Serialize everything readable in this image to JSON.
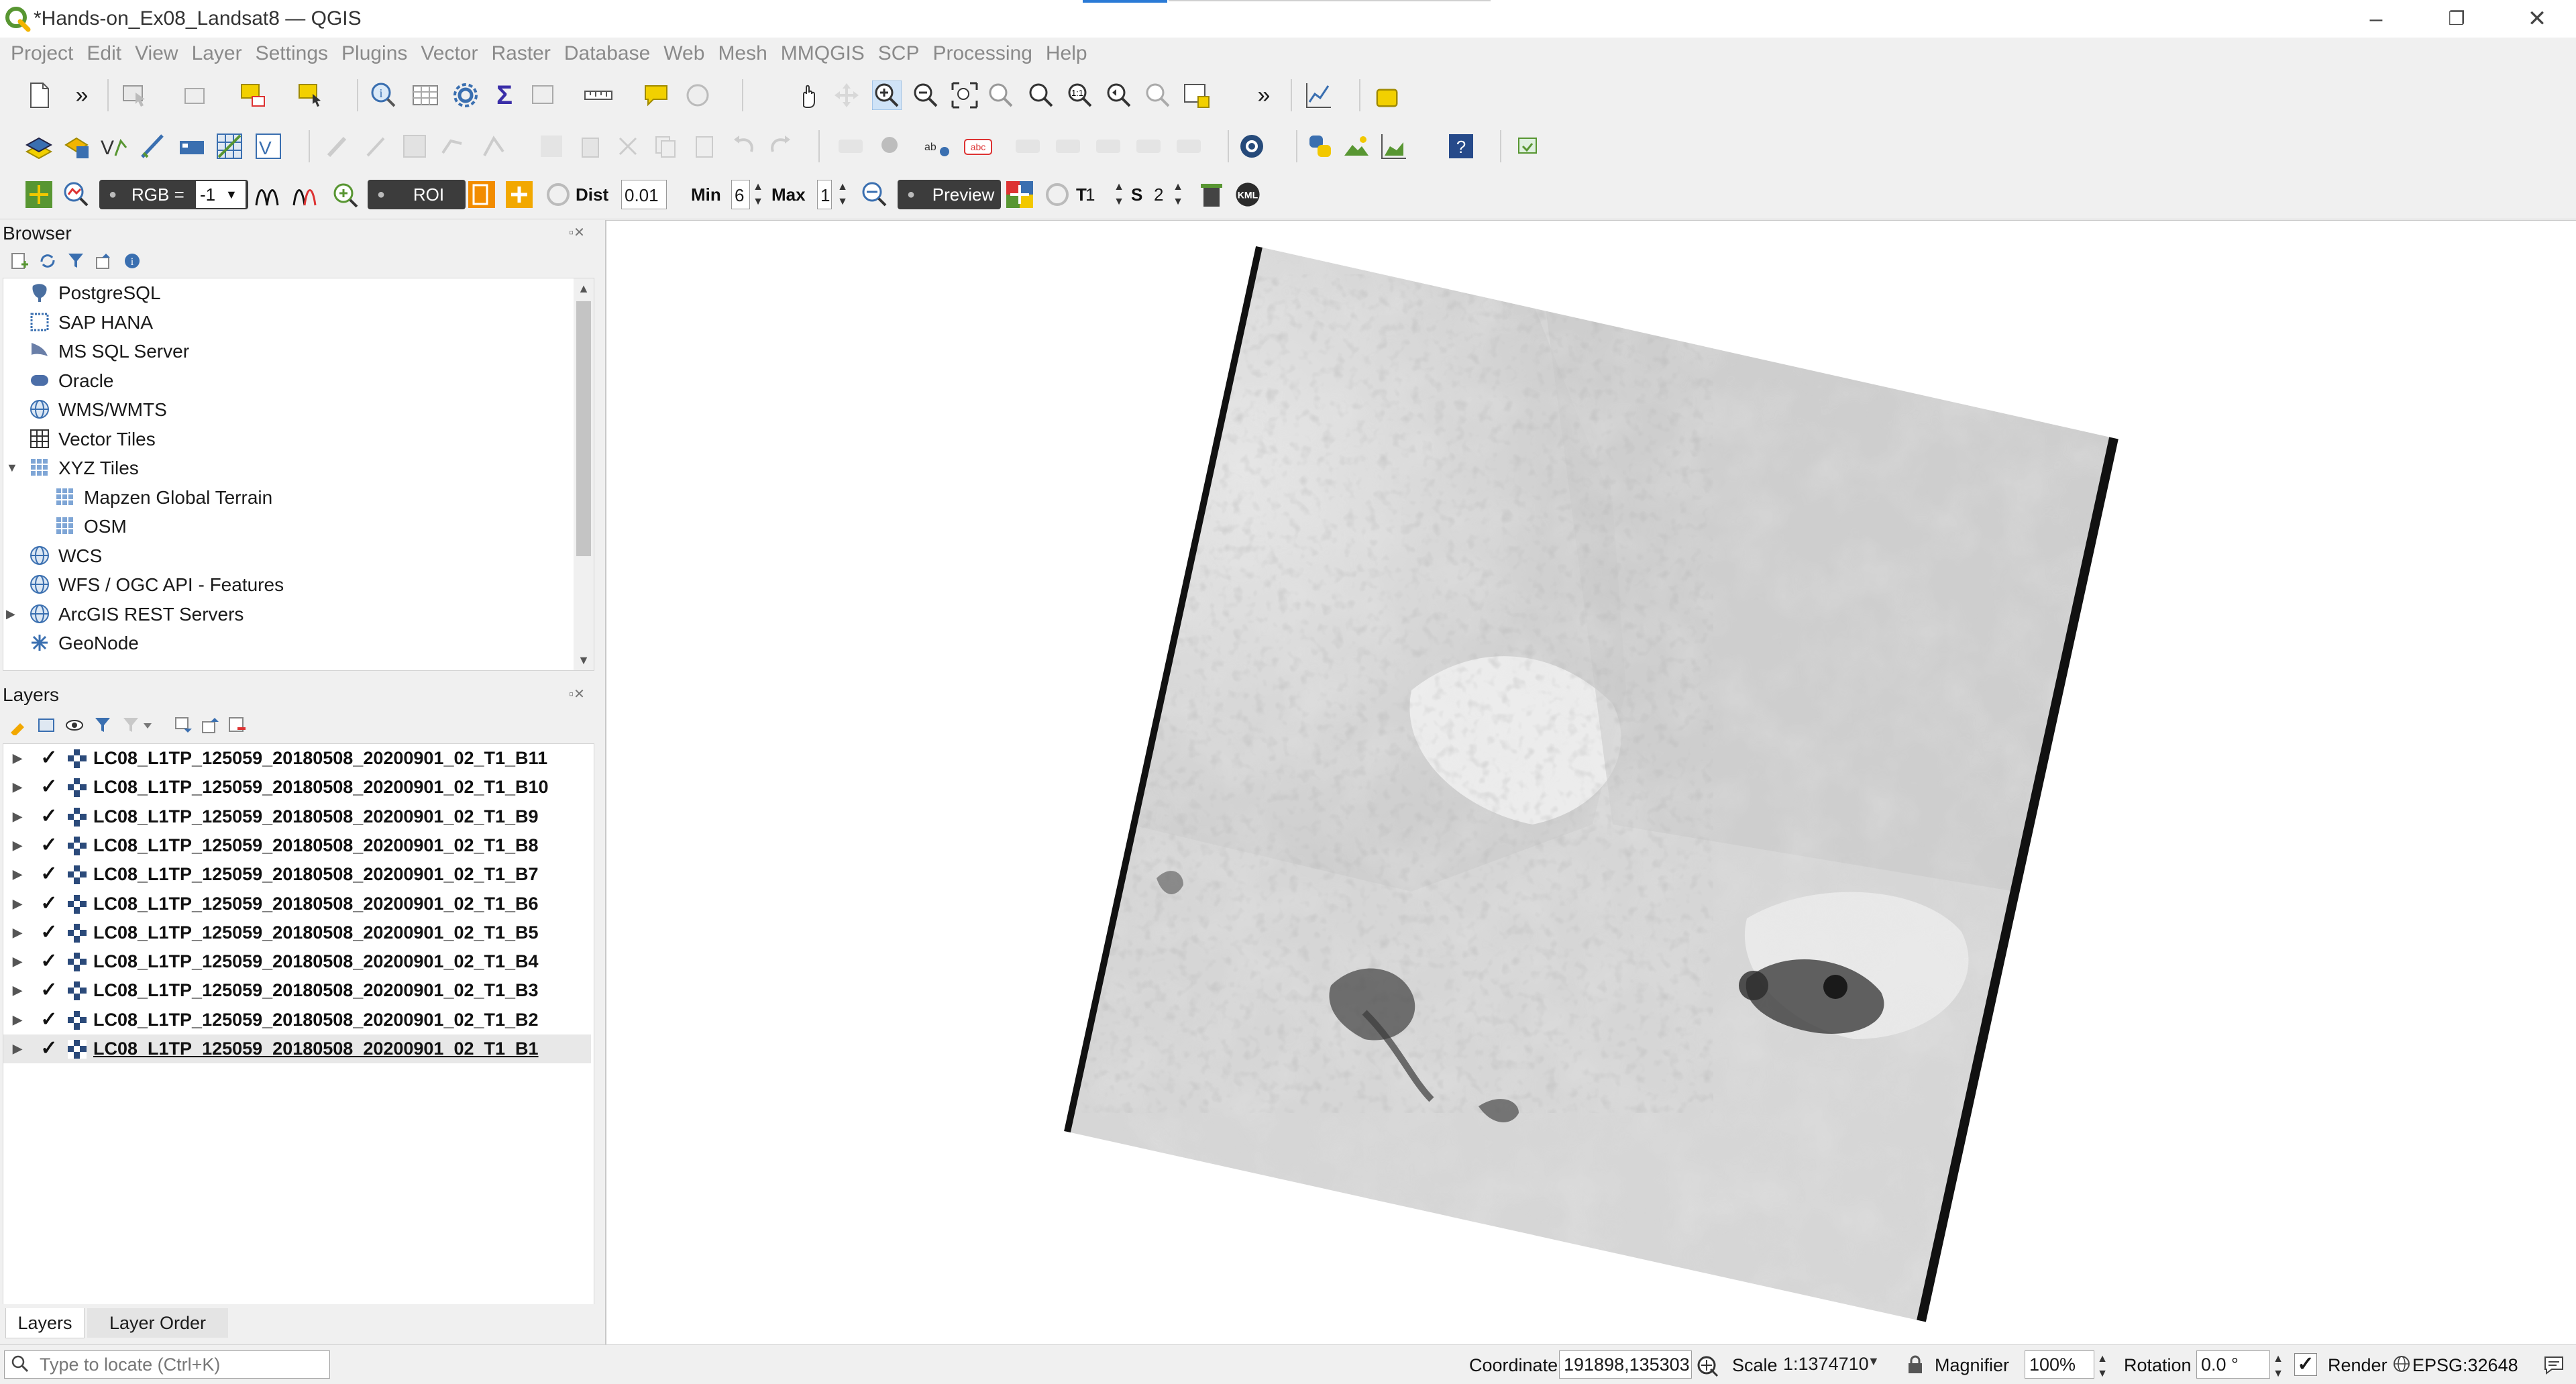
{
  "window": {
    "title": "*Hands-on_Ex08_Landsat8 — QGIS",
    "minimize_icon": "minimize-icon",
    "restore_icon": "restore-icon",
    "close_icon": "close-icon"
  },
  "menu": [
    "Project",
    "Edit",
    "View",
    "Layer",
    "Settings",
    "Plugins",
    "Vector",
    "Raster",
    "Database",
    "Web",
    "Mesh",
    "MMQGIS",
    "SCP",
    "Processing",
    "Help"
  ],
  "scp_toolbar": {
    "rgb_label": "RGB =",
    "rgb_value": "-1",
    "roi_label": "ROI",
    "dist_label": "Dist",
    "dist_value": "0.01",
    "min_label": "Min",
    "min_value": "6",
    "max_label": "Max",
    "max_value": "1",
    "preview_label": "Preview",
    "t_label": "T",
    "t_value": "1",
    "s_label": "S",
    "s_value": "2",
    "kml_label": "KML"
  },
  "browser": {
    "title": "Browser",
    "items": [
      {
        "label": "PostgreSQL",
        "icon": "postgresql-icon",
        "level": 0,
        "expander": ""
      },
      {
        "label": "SAP HANA",
        "icon": "sap-hana-icon",
        "level": 0,
        "expander": ""
      },
      {
        "label": "MS SQL Server",
        "icon": "mssql-icon",
        "level": 0,
        "expander": ""
      },
      {
        "label": "Oracle",
        "icon": "oracle-icon",
        "level": 0,
        "expander": ""
      },
      {
        "label": "WMS/WMTS",
        "icon": "wms-icon",
        "level": 0,
        "expander": ""
      },
      {
        "label": "Vector Tiles",
        "icon": "vector-tiles-icon",
        "level": 0,
        "expander": ""
      },
      {
        "label": "XYZ Tiles",
        "icon": "xyz-tiles-icon",
        "level": 0,
        "expander": "▼"
      },
      {
        "label": "Mapzen Global Terrain",
        "icon": "tile-grid-icon",
        "level": 1,
        "expander": ""
      },
      {
        "label": "OSM",
        "icon": "tile-grid-icon",
        "level": 1,
        "expander": ""
      },
      {
        "label": "WCS",
        "icon": "wcs-icon",
        "level": 0,
        "expander": ""
      },
      {
        "label": "WFS / OGC API - Features",
        "icon": "wfs-icon",
        "level": 0,
        "expander": ""
      },
      {
        "label": "ArcGIS REST Servers",
        "icon": "arcgis-icon",
        "level": 0,
        "expander": "▶"
      },
      {
        "label": "GeoNode",
        "icon": "geonode-icon",
        "level": 0,
        "expander": ""
      }
    ]
  },
  "layers": {
    "title": "Layers",
    "items": [
      {
        "name": "LC08_L1TP_125059_20180508_20200901_02_T1_B11",
        "checked": true
      },
      {
        "name": "LC08_L1TP_125059_20180508_20200901_02_T1_B10",
        "checked": true
      },
      {
        "name": "LC08_L1TP_125059_20180508_20200901_02_T1_B9",
        "checked": true
      },
      {
        "name": "LC08_L1TP_125059_20180508_20200901_02_T1_B8",
        "checked": true
      },
      {
        "name": "LC08_L1TP_125059_20180508_20200901_02_T1_B7",
        "checked": true
      },
      {
        "name": "LC08_L1TP_125059_20180508_20200901_02_T1_B6",
        "checked": true
      },
      {
        "name": "LC08_L1TP_125059_20180508_20200901_02_T1_B5",
        "checked": true
      },
      {
        "name": "LC08_L1TP_125059_20180508_20200901_02_T1_B4",
        "checked": true
      },
      {
        "name": "LC08_L1TP_125059_20180508_20200901_02_T1_B3",
        "checked": true
      },
      {
        "name": "LC08_L1TP_125059_20180508_20200901_02_T1_B2",
        "checked": true
      },
      {
        "name": "LC08_L1TP_125059_20180508_20200901_02_T1_B1",
        "checked": true
      }
    ],
    "tabs": [
      "Layers",
      "Layer Order"
    ]
  },
  "status": {
    "locate_placeholder": "Type to locate (Ctrl+K)",
    "coordinate_label": "Coordinate",
    "coordinate_value": "191898,135303",
    "scale_label": "Scale",
    "scale_value": "1:1374710",
    "magnifier_label": "Magnifier",
    "magnifier_value": "100%",
    "rotation_label": "Rotation",
    "rotation_value": "0.0 °",
    "render_label": "Render",
    "crs": "EPSG:32648"
  },
  "colors": {
    "accent": "#2a7ad6",
    "qgis_green": "#589632",
    "qgis_yellow": "#f2b500"
  }
}
